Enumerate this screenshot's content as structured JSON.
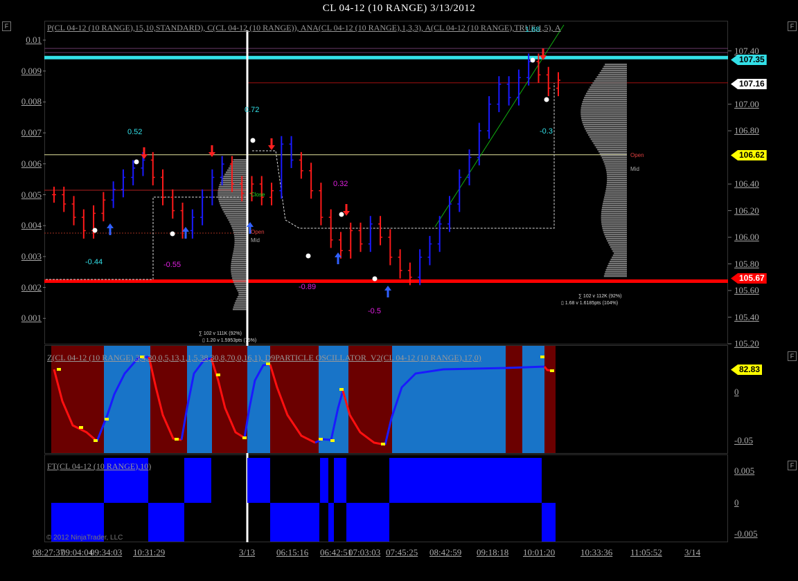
{
  "window": {
    "title": "CL 04-12 (10 RANGE)  3/13/2012",
    "f_button": "F",
    "copyright": "© 2012 NinjaTrader, LLC"
  },
  "panels": {
    "price": {
      "label": "P(CL 04-12 (10 RANGE),15,10,STANDARD), C(CL 04-12 (10 RANGE)), ANA(CL 04-12 (10 RANGE),1,3,3), A(CL 04-12 (10 RANGE),TRUE,1,5), A"
    },
    "oscillator": {
      "label": "Z(CL 04-12 (10 RANGE),3,4,30,0,5,13,1,1,5,38,30,8,70,0,16,1), D9PARTICLE OSCILLATOR_V2(CL 04-12 (10 RANGE),17,0)"
    },
    "ft": {
      "label": "FT(CL 04-12 (10 RANGE),10)"
    }
  },
  "axes": {
    "left_ticks": [
      "0.01",
      "0.009",
      "0.008",
      "0.007",
      "0.006",
      "0.005",
      "0.004",
      "0.003",
      "0.002",
      "0.001"
    ],
    "right_ticks": [
      "107.40",
      "107.00",
      "106.80",
      "106.40",
      "106.20",
      "106.00",
      "105.80",
      "105.60",
      "105.40",
      "105.20"
    ],
    "osc_ticks": [
      "0",
      "-0.05"
    ],
    "ft_ticks": [
      "0.005",
      "0",
      "-0.005"
    ],
    "x_ticks": [
      "08:27:37",
      "09:04:04",
      "09:34:03",
      "10:31:29",
      "3/13",
      "06:15:16",
      "06:42:51",
      "07:03:03",
      "07:45:25",
      "08:42:59",
      "09:18:18",
      "10:01:20",
      "10:33:36",
      "11:05:52",
      "3/14"
    ]
  },
  "price_tags": {
    "top": "107.35",
    "last": "107.16",
    "yellow": "106.62",
    "bottom": "105.67",
    "osc": "82.83"
  },
  "colors": {
    "up": "#1a1aff",
    "down": "#ff1a1a",
    "cyan": "#33e0e8",
    "red_level": "#ff0000",
    "osc_red_bg": "#6b0000",
    "osc_blue_bg": "#1874c8",
    "ft_blue": "#0000ff"
  },
  "annotations": {
    "swing_labels": [
      "0.52",
      "-0.44",
      "-0.55",
      "0.72",
      "0.32",
      "-0.89",
      "-0.5",
      "1.68",
      "-0.3"
    ],
    "open_label": "Open",
    "mid_label": "Mid",
    "close_label": "Close",
    "stats_left_1": "∑ 102 v 111K (92%)",
    "stats_left_2": "▯ 1.20  v  1.5953pts  (75%)",
    "stats_right_1": "∑ 102 v 112K (92%)",
    "stats_right_2": "▯ 1.68  v  1.6185pts  (104%)"
  },
  "chart_data": {
    "type": "bar",
    "instrument": "CL 04-12 (10 RANGE)",
    "date": "3/13/2012",
    "bar_type": "range",
    "right_axis_range": [
      105.2,
      107.45
    ],
    "price_levels": {
      "cyan_resistance": 107.35,
      "last": 107.16,
      "yellow_open": 106.62,
      "red_support": 105.67
    },
    "price_path": [
      {
        "p": 106.32,
        "d": "down"
      },
      {
        "p": 106.25,
        "d": "down"
      },
      {
        "p": 106.15,
        "d": "down"
      },
      {
        "p": 106.05,
        "d": "down"
      },
      {
        "p": 106.18,
        "d": "down"
      },
      {
        "p": 106.28,
        "d": "down"
      },
      {
        "p": 106.36,
        "d": "up"
      },
      {
        "p": 106.45,
        "d": "up"
      },
      {
        "p": 106.52,
        "d": "up"
      },
      {
        "p": 106.58,
        "d": "up"
      },
      {
        "p": 106.45,
        "d": "down"
      },
      {
        "p": 106.3,
        "d": "down"
      },
      {
        "p": 106.2,
        "d": "down"
      },
      {
        "p": 106.05,
        "d": "down"
      },
      {
        "p": 106.15,
        "d": "up"
      },
      {
        "p": 106.3,
        "d": "up"
      },
      {
        "p": 106.45,
        "d": "up"
      },
      {
        "p": 106.55,
        "d": "up"
      },
      {
        "p": 106.4,
        "d": "down"
      },
      {
        "p": 106.33,
        "d": "down"
      },
      {
        "p": 106.4,
        "d": "down"
      },
      {
        "p": 106.3,
        "d": "down"
      },
      {
        "p": 106.35,
        "d": "down"
      },
      {
        "p": 106.7,
        "d": "up"
      },
      {
        "p": 106.58,
        "d": "up"
      },
      {
        "p": 106.5,
        "d": "down"
      },
      {
        "p": 106.35,
        "d": "down"
      },
      {
        "p": 106.15,
        "d": "down"
      },
      {
        "p": 105.98,
        "d": "down"
      },
      {
        "p": 105.9,
        "d": "down"
      },
      {
        "p": 106.05,
        "d": "down"
      },
      {
        "p": 105.95,
        "d": "down"
      },
      {
        "p": 106.1,
        "d": "up"
      },
      {
        "p": 106.0,
        "d": "down"
      },
      {
        "p": 105.85,
        "d": "down"
      },
      {
        "p": 105.75,
        "d": "down"
      },
      {
        "p": 105.7,
        "d": "down"
      },
      {
        "p": 105.85,
        "d": "up"
      },
      {
        "p": 105.95,
        "d": "up"
      },
      {
        "p": 106.1,
        "d": "up"
      },
      {
        "p": 106.25,
        "d": "up"
      },
      {
        "p": 106.45,
        "d": "up"
      },
      {
        "p": 106.6,
        "d": "up"
      },
      {
        "p": 106.8,
        "d": "up"
      },
      {
        "p": 107.0,
        "d": "up"
      },
      {
        "p": 107.15,
        "d": "up"
      },
      {
        "p": 107.05,
        "d": "up"
      },
      {
        "p": 107.2,
        "d": "up"
      },
      {
        "p": 107.32,
        "d": "up"
      },
      {
        "p": 107.22,
        "d": "down"
      },
      {
        "p": 107.12,
        "d": "down"
      },
      {
        "p": 107.18,
        "d": "down"
      }
    ],
    "swing_points": [
      {
        "label": "0.52",
        "p": 106.58
      },
      {
        "label": "-0.44",
        "p": 106.05
      },
      {
        "label": "-0.55",
        "p": 106.05
      },
      {
        "label": "0.72",
        "p": 106.7
      },
      {
        "label": "0.32",
        "p": 106.1
      },
      {
        "label": "-0.89",
        "p": 105.7
      },
      {
        "label": "-0.5",
        "p": 105.7
      },
      {
        "label": "1.68",
        "p": 107.35
      },
      {
        "label": "-0.3",
        "p": 107.05
      }
    ],
    "oscillator": {
      "last_value": 82.83,
      "segments": [
        "down",
        "up",
        "down",
        "up",
        "down",
        "up",
        "down",
        "up",
        "down",
        "up",
        "down",
        "up"
      ]
    },
    "ft_histogram": [
      "-",
      "+",
      "-",
      "+",
      "-",
      "+",
      "-",
      "+",
      "+",
      "+",
      "-",
      "+",
      "-"
    ]
  }
}
